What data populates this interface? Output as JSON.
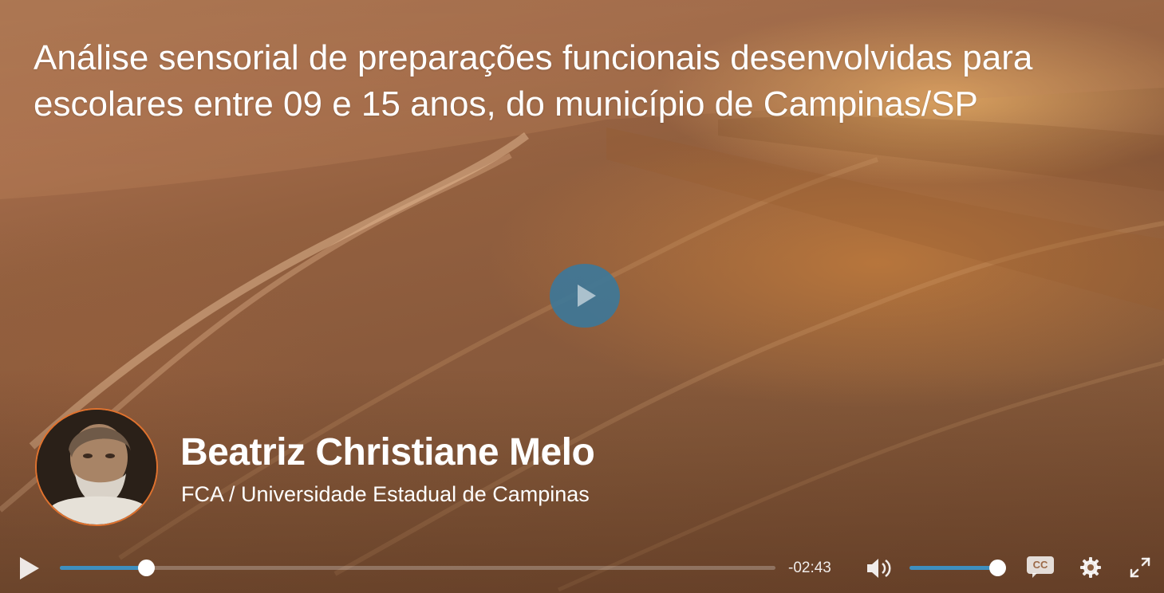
{
  "video": {
    "title": "Análise sensorial de preparações funcionais desenvolvidas para escolares entre 09 e 15 anos, do município de Campinas/SP"
  },
  "author": {
    "name": "Beatriz Christiane Melo",
    "affiliation": "FCA / Universidade Estadual de Campinas",
    "avatar_border_color": "#e0722e"
  },
  "controls": {
    "play_icon": "play-icon",
    "time_remaining": "-02:43",
    "progress_fraction": 0.12,
    "volume_fraction": 1.0,
    "volume_icon": "volume-icon",
    "captions_label": "CC",
    "settings_icon": "gear-icon",
    "fullscreen_icon": "fullscreen-icon"
  },
  "colors": {
    "accent": "#3e8fbf",
    "big_play_button": "#3e7798"
  }
}
